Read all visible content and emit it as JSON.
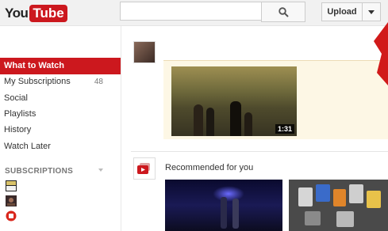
{
  "header": {
    "logo_you": "You",
    "logo_tube": "Tube",
    "search_placeholder": "",
    "upload_label": "Upload"
  },
  "sidebar": {
    "items": [
      {
        "label": "What to Watch",
        "active": true
      },
      {
        "label": "My Subscriptions",
        "count": "48"
      },
      {
        "label": "Social"
      },
      {
        "label": "Playlists"
      },
      {
        "label": "History"
      },
      {
        "label": "Watch Later"
      }
    ],
    "subscriptions_heading": "SUBSCRIPTIONS",
    "subscriptions_channel_thumbs": [
      "jamie-oliver-thumb",
      "channel-thumb",
      "pc-thumb"
    ]
  },
  "feed": {
    "video": {
      "duration": "1:31"
    },
    "recommended_title": "Recommended for you"
  },
  "colors": {
    "brand_red": "#cc181e",
    "feed_card_bg": "#fdf7e5",
    "header_bg": "#f1f1f1"
  }
}
